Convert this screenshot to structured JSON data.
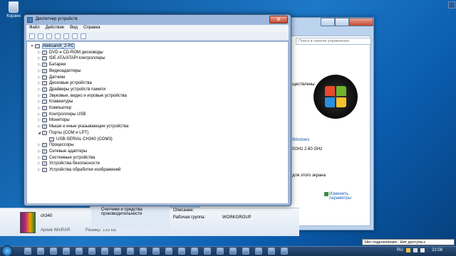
{
  "desktop": {
    "recycle_bin_label": "Корзин"
  },
  "system_window": {
    "search_placeholder": "Поиск в панели управления",
    "text_lines": {
      "uщeственные": "ществлены:",
      "windows": "Windows",
      "cpu": "0GHz   2.60 GHz",
      "screen": "для этого экрана"
    },
    "change_link": "Изменить параметры",
    "nav_label": "Счетчики и средства производительности",
    "desc_label": "Описание:",
    "workgroup_label": "Рабочая группа:",
    "workgroup_value": "WORKGROUP"
  },
  "file_info": {
    "name": "ch340",
    "type": "Архив WinRAR",
    "size_label": "Размер: 133 КБ"
  },
  "device_manager": {
    "title": "Диспетчер устройств",
    "menu": [
      "Файл",
      "Действие",
      "Вид",
      "Справка"
    ],
    "tree": [
      {
        "label": "Aleksandr_2-PC",
        "level": 0,
        "arrow": "▼",
        "selected": true
      },
      {
        "label": "DVD и CD-ROM дисководы",
        "level": 1,
        "arrow": "▷"
      },
      {
        "label": "IDE ATA/ATAPI контроллеры",
        "level": 1,
        "arrow": "▷"
      },
      {
        "label": "Батареи",
        "level": 1,
        "arrow": "▷"
      },
      {
        "label": "Видеоадаптеры",
        "level": 1,
        "arrow": "▷"
      },
      {
        "label": "Датчики",
        "level": 1,
        "arrow": "▷"
      },
      {
        "label": "Дисковые устройства",
        "level": 1,
        "arrow": "▷"
      },
      {
        "label": "Драйверы устройств памяти",
        "level": 1,
        "arrow": "▷"
      },
      {
        "label": "Звуковые, видео и игровые устройства",
        "level": 1,
        "arrow": "▷"
      },
      {
        "label": "Клавиатуры",
        "level": 1,
        "arrow": "▷"
      },
      {
        "label": "Компьютер",
        "level": 1,
        "arrow": "▷"
      },
      {
        "label": "Контроллеры USB",
        "level": 1,
        "arrow": "▷"
      },
      {
        "label": "Мониторы",
        "level": 1,
        "arrow": "▷"
      },
      {
        "label": "Мыши и иные указывающие устройства",
        "level": 1,
        "arrow": "▷"
      },
      {
        "label": "Порты (COM и LPT)",
        "level": 1,
        "arrow": "◢"
      },
      {
        "label": "USB-SERIAL CH340 (COM3)",
        "level": 2,
        "arrow": ""
      },
      {
        "label": "Процессоры",
        "level": 1,
        "arrow": "▷"
      },
      {
        "label": "Сетевые адаптеры",
        "level": 1,
        "arrow": "▷"
      },
      {
        "label": "Системные устройства",
        "level": 1,
        "arrow": "▷"
      },
      {
        "label": "Устройства безопасности",
        "level": 1,
        "arrow": "▷"
      },
      {
        "label": "Устройства обработки изображений",
        "level": 1,
        "arrow": "▷"
      }
    ]
  },
  "taskbar": {
    "tooltip": "Нет подключения - Нет доступа к",
    "lang": "RU",
    "time": "22:08"
  },
  "colors": {
    "desktop": "#1d78c8",
    "title_bar": "#9db8dc",
    "selection": "#cde2f7"
  }
}
